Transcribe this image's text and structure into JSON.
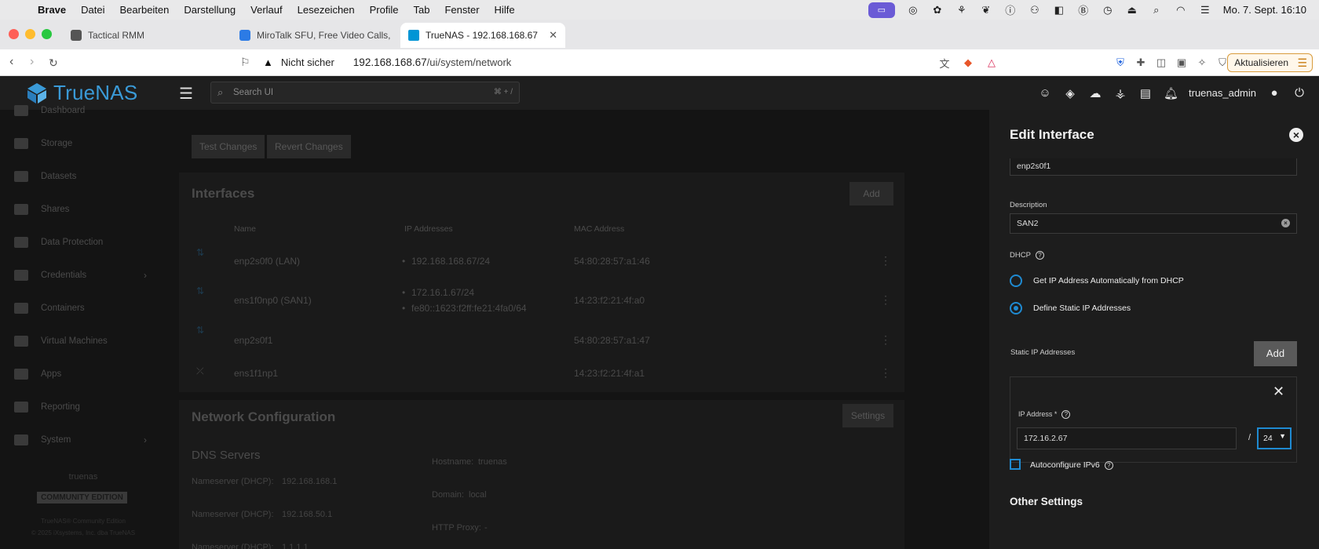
{
  "menubar": {
    "app": "Brave",
    "items": [
      "Datei",
      "Bearbeiten",
      "Darstellung",
      "Verlauf",
      "Lesezeichen",
      "Profile",
      "Tab",
      "Fenster",
      "Hilfe"
    ],
    "datetime": "Mo. 7. Sept.  16:10"
  },
  "browser": {
    "tabs": [
      {
        "label": "Tactical RMM",
        "icon": "tactical-rmm-icon",
        "color": "#444"
      },
      {
        "label": "MiroTalk SFU, Free Video Calls,",
        "icon": "mirotalk-icon",
        "color": "#2c7be5"
      },
      {
        "label": "TrueNAS - 192.168.168.67",
        "icon": "truenas-icon",
        "color": "#0095d5"
      }
    ],
    "not_secure": "Nicht sicher",
    "url_host": "192.168.168.67",
    "url_path": "/ui/system/network",
    "update_label": "Aktualisieren"
  },
  "topbar": {
    "brand": "TrueNAS",
    "search_placeholder": "Search UI",
    "search_shortcut": "⌘ + /",
    "username": "truenas_admin"
  },
  "sidebar": {
    "items": [
      {
        "label": "Dashboard",
        "icon": "dashboard-icon"
      },
      {
        "label": "Storage",
        "icon": "storage-icon"
      },
      {
        "label": "Datasets",
        "icon": "datasets-icon"
      },
      {
        "label": "Shares",
        "icon": "shares-icon"
      },
      {
        "label": "Data Protection",
        "icon": "shield-icon"
      },
      {
        "label": "Credentials",
        "icon": "key-icon"
      },
      {
        "label": "Containers",
        "icon": "containers-icon"
      },
      {
        "label": "Virtual Machines",
        "icon": "monitor-icon"
      },
      {
        "label": "Apps",
        "icon": "apps-icon"
      },
      {
        "label": "Reporting",
        "icon": "chart-icon"
      },
      {
        "label": "System",
        "icon": "gear-icon"
      }
    ],
    "hostname": "truenas",
    "edition": "COMMUNITY EDITION",
    "footer1": "TrueNAS® Community Edition",
    "footer2": "© 2025 iXsystems, Inc. dba TrueNAS"
  },
  "network": {
    "test_changes": "Test Changes",
    "revert_changes": "Revert Changes",
    "interfaces_title": "Interfaces",
    "add_label": "Add",
    "columns": [
      "Name",
      "IP Addresses",
      "MAC Address"
    ],
    "rows": [
      {
        "name": "enp2s0f0 (LAN)",
        "ips": [
          "192.168.168.67/24"
        ],
        "mac": "54:80:28:57:a1:46"
      },
      {
        "name": "ens1f0np0 (SAN1)",
        "ips": [
          "172.16.1.67/24",
          "fe80::1623:f2ff:fe21:4fa0/64"
        ],
        "mac": "14:23:f2:21:4f:a0"
      },
      {
        "name": "enp2s0f1",
        "ips": [],
        "mac": "54:80:28:57:a1:47"
      },
      {
        "name": "ens1f1np1",
        "ips": [],
        "mac": "14:23:f2:21:4f:a1"
      }
    ],
    "netconf_title": "Network Configuration",
    "settings_label": "Settings",
    "dns_title": "DNS Servers",
    "nameservers": [
      {
        "label": "Nameserver (DHCP):",
        "value": "192.168.168.1"
      },
      {
        "label": "Nameserver (DHCP):",
        "value": "192.168.50.1"
      },
      {
        "label": "Nameserver (DHCP):",
        "value": "1.1.1.1"
      }
    ],
    "hostname_label": "Hostname:",
    "hostname_value": "truenas",
    "domain_label": "Domain:",
    "domain_value": "local",
    "proxy_label": "HTTP Proxy:",
    "proxy_value": "-"
  },
  "panel": {
    "title": "Edit Interface",
    "name_value": "enp2s0f1",
    "description_label": "Description",
    "description_value": "SAN2",
    "dhcp_label": "DHCP",
    "radio_dhcp": "Get IP Address Automatically from DHCP",
    "radio_static": "Define Static IP Addresses",
    "static_label": "Static IP Addresses",
    "add_label": "Add",
    "ip_label": "IP Address *",
    "ip_value": "172.16.2.67",
    "slash": "/",
    "cidr_value": "24",
    "ipv6_label": "Autoconfigure IPv6",
    "other_settings": "Other Settings",
    "accent": "#1f8ad1"
  }
}
